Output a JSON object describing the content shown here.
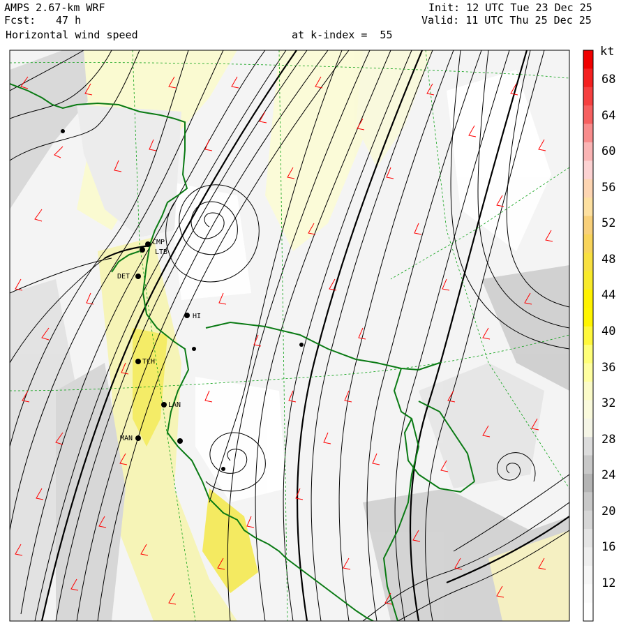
{
  "header": {
    "title": "AMPS 2.67-km WRF",
    "fcst_label": "Fcst:",
    "fcst_value": "47 h",
    "field": "Horizontal wind speed",
    "level": "at k-index =  55",
    "init": "Init: 12 UTC Tue 23 Dec 25",
    "valid": "Valid: 11 UTC Thu 25 Dec 25"
  },
  "colorbar": {
    "unit": "kt",
    "labels": [
      "68",
      "64",
      "60",
      "56",
      "52",
      "48",
      "44",
      "40",
      "36",
      "32",
      "28",
      "24",
      "20",
      "16",
      "12"
    ],
    "colors": [
      "#f00000",
      "#f42020",
      "#f54040",
      "#f66060",
      "#f88c8c",
      "#fab4b4",
      "#fcd2d2",
      "#fdd5b2",
      "#fde0a0",
      "#f8d07a",
      "#f8d45a",
      "#f8e040",
      "#f8ea2a",
      "#fff200",
      "#fff500",
      "#fff83c",
      "#ffff78",
      "#ffffa0",
      "#fbfbc8",
      "#fafadc",
      "#f5f5e6",
      "#dcdcdc",
      "#c8c8c8",
      "#b4b4b4",
      "#c8c8c8",
      "#d6d6d6",
      "#e4e4e4",
      "#eeeeee",
      "#f6f6f6",
      "#fbfbfb",
      "#ffffff"
    ]
  },
  "stations": [
    "CMP",
    "LTB",
    "DET",
    "HI",
    "TCH",
    "LAN",
    "MAN"
  ],
  "style": {
    "contour": "#000000",
    "barb": "#ff0000",
    "coast": "#0a7a14",
    "grid": "#0aa014"
  }
}
